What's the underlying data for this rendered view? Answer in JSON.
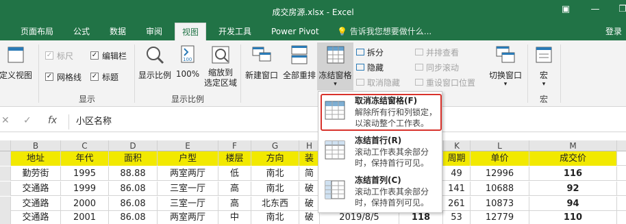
{
  "window": {
    "title": "成交房源.xlsx - Excel"
  },
  "tabs": [
    "页面布局",
    "公式",
    "数据",
    "审阅",
    "视图",
    "开发工具",
    "Power Pivot"
  ],
  "active_tab": "视图",
  "tell_me": "告诉我您想要做什么...",
  "login": "登录",
  "ribbon": {
    "custom_view": "定义视图",
    "show": {
      "ruler": "标尺",
      "edit_bar": "编辑栏",
      "gridlines": "网格线",
      "headings": "标题",
      "group": "显示"
    },
    "zoom": {
      "zoom": "显示比例",
      "hundred": "100%",
      "zoom_sel_1": "缩放到",
      "zoom_sel_2": "选定区域",
      "group": "显示比例"
    },
    "window": {
      "new_window": "新建窗口",
      "arrange_all": "全部重排",
      "freeze": "冻结窗格",
      "split": "拆分",
      "hide": "隐藏",
      "unhide": "取消隐藏",
      "side_by_side": "并排查看",
      "sync_scroll": "同步滚动",
      "reset_pos": "重设窗口位置",
      "switch": "切换窗口"
    },
    "macro": {
      "macro": "宏",
      "group": "宏"
    }
  },
  "formula_bar": {
    "content": "小区名称"
  },
  "columns": [
    "B",
    "C",
    "D",
    "E",
    "F",
    "G",
    "H",
    "K",
    "L",
    "M"
  ],
  "header_row": [
    "地址",
    "年代",
    "面积",
    "户型",
    "楼层",
    "方向",
    "装",
    "价",
    "周期",
    "单价",
    "成交价"
  ],
  "rows": [
    [
      "勤劳街",
      "1995",
      "88.88",
      "两室两厅",
      "低",
      "南北",
      "简",
      "49",
      "12996",
      "116"
    ],
    [
      "交通路",
      "1999",
      "86.08",
      "三室一厅",
      "高",
      "南北",
      "破",
      "141",
      "10688",
      "92"
    ],
    [
      "交通路",
      "2000",
      "86.08",
      "三室一厅",
      "高",
      "北东西",
      "破",
      "261",
      "10873",
      "94"
    ],
    [
      "交通路",
      "2001",
      "86.08",
      "两室两厅",
      "中",
      "南北",
      "破",
      "53",
      "12779",
      "110"
    ]
  ],
  "last_row_extra": {
    "date": "2019/8/5",
    "price": "118"
  },
  "dropdown": {
    "unfreeze": {
      "title": "取消冻结窗格(F)",
      "desc": "解除所有行和列锁定，以滚动整个工作表。"
    },
    "freeze_top_row": {
      "title": "冻结首行(R)",
      "desc": "滚动工作表其余部分时，保持首行可见。"
    },
    "freeze_first_col": {
      "title": "冻结首列(C)",
      "desc": "滚动工作表其余部分时，保持首列可见。"
    }
  },
  "colors": {
    "excel_green": "#217346",
    "header_yellow": "#f2e900",
    "highlight_red": "#d8322b"
  }
}
